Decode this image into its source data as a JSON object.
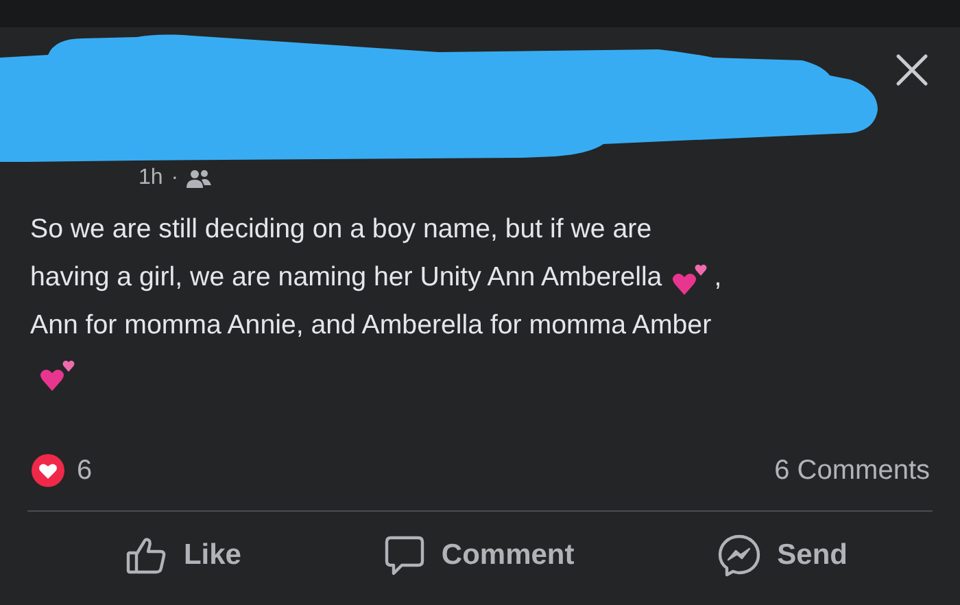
{
  "post": {
    "time": "1h",
    "separator": "·",
    "lines": [
      [
        {
          "kind": "text",
          "text": "So we are still deciding on a boy name, but if we are"
        }
      ],
      [
        {
          "kind": "text",
          "text": "having a girl, we are naming her Unity Ann Amberella"
        },
        {
          "kind": "emoji"
        },
        {
          "kind": "text",
          "text": ","
        }
      ],
      [
        {
          "kind": "text",
          "text": "Ann for momma Annie, and Amberella for momma Amber"
        }
      ],
      [
        {
          "kind": "emoji"
        }
      ]
    ]
  },
  "reactions": {
    "count": "6",
    "comments": "6 Comments"
  },
  "actions": [
    {
      "kind": "like",
      "label": "Like"
    },
    {
      "kind": "comment",
      "label": "Comment"
    },
    {
      "kind": "send",
      "label": "Send"
    }
  ]
}
